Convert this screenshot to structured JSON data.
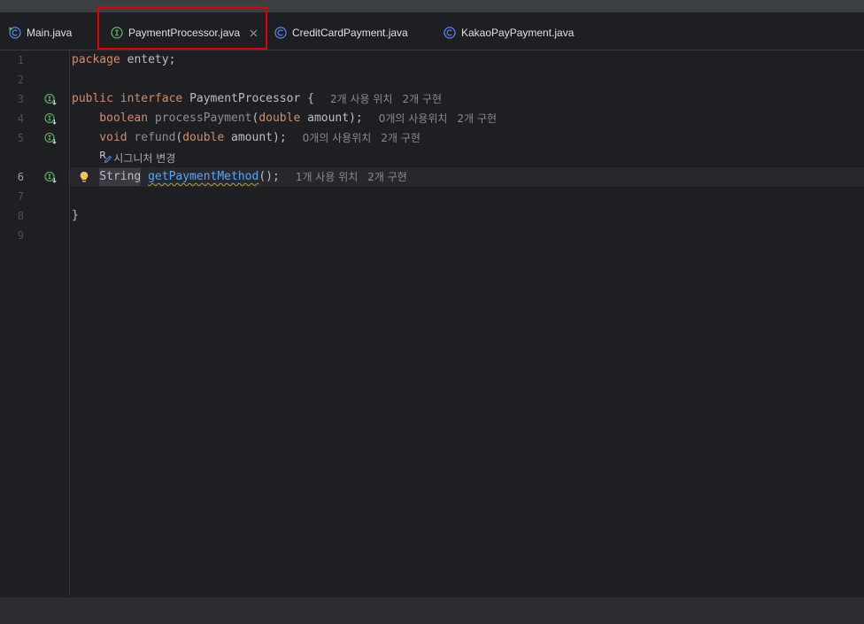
{
  "tabs": [
    {
      "label": "Main.java",
      "icon": "main-class-icon",
      "active": false
    },
    {
      "label": "PaymentProcessor.java",
      "icon": "interface-icon",
      "active": true,
      "close_icon": "close-icon"
    },
    {
      "label": "CreditCardPayment.java",
      "icon": "class-icon",
      "active": false
    },
    {
      "label": "KakaoPayPayment.java",
      "icon": "class-icon",
      "active": false
    }
  ],
  "annotation": {
    "border_color": "#e00000"
  },
  "editor": {
    "current_line": 6,
    "lines": [
      {
        "number": "1",
        "tokens": [
          {
            "text": "package",
            "color": "#cf8e6d"
          },
          {
            "text": " entety;",
            "color": "#bcbec4"
          }
        ]
      },
      {
        "number": "2",
        "tokens": []
      },
      {
        "number": "3",
        "gutter_icon": "implemented-interface-icon",
        "tokens": [
          {
            "text": "public",
            "color": "#cf8e6d"
          },
          {
            "text": " interface",
            "color": "#cf8e6d"
          },
          {
            "text": " PaymentProcessor {",
            "color": "#bcbec4"
          }
        ],
        "hints": [
          "2개 사용 위치",
          "2개 구현"
        ]
      },
      {
        "number": "4",
        "gutter_icon": "implemented-interface-icon",
        "tokens": [
          {
            "text": "boolean",
            "color": "#cf8e6d"
          },
          {
            "text": " processPayment",
            "color": "#8c8f94"
          },
          {
            "text": "(",
            "color": "#bcbec4"
          },
          {
            "text": "double",
            "color": "#cf8e6d"
          },
          {
            "text": " amount);",
            "color": "#bcbec4"
          }
        ],
        "hints": [
          "0개의 사용위치",
          "2개 구현"
        ]
      },
      {
        "number": "5",
        "gutter_icon": "implemented-interface-icon",
        "tokens": [
          {
            "text": "void",
            "color": "#cf8e6d"
          },
          {
            "text": " refund",
            "color": "#8c8f94"
          },
          {
            "text": "(",
            "color": "#bcbec4"
          },
          {
            "text": "double",
            "color": "#cf8e6d"
          },
          {
            "text": " amount);",
            "color": "#bcbec4"
          }
        ],
        "hints": [
          "0개의 사용위치",
          "2개 구현"
        ]
      },
      {
        "number": "6",
        "gutter_icon": "implemented-interface-icon",
        "intention_icon": "lightbulb-icon",
        "tokens": [
          {
            "text": "String",
            "color": "#bcbec4",
            "background": "#393b40"
          },
          {
            "text": " ",
            "color": "#bcbec4"
          },
          {
            "text": "getPaymentMethod",
            "color": "#56a8f5",
            "underline": "#b4a03c"
          },
          {
            "text": "();",
            "color": "#bcbec4"
          }
        ],
        "hints": [
          "1개 사용 위치",
          "2개 구현"
        ]
      },
      {
        "number": "7",
        "tokens": []
      },
      {
        "number": "8",
        "tokens": [
          {
            "text": "}",
            "color": "#bcbec4"
          }
        ]
      },
      {
        "number": "9",
        "tokens": []
      }
    ],
    "signature_change_hint": {
      "icon": "rename-refactoring-icon",
      "icon_letter": "R",
      "label": "시그니처 변경",
      "color": "#a8abb0"
    }
  },
  "theme": {
    "window_top_bg": "#3c3f41",
    "tabbar_bg": "#1e1f22",
    "editor_bg": "#1e1f22",
    "current_line_bg": "#26282e",
    "gutter_separator": "#313438",
    "status_bar_bg": "#2b2d30",
    "interface_icon": "#5fb865",
    "class_icon": "#548af7",
    "lightbulb": "#f2c55c"
  }
}
